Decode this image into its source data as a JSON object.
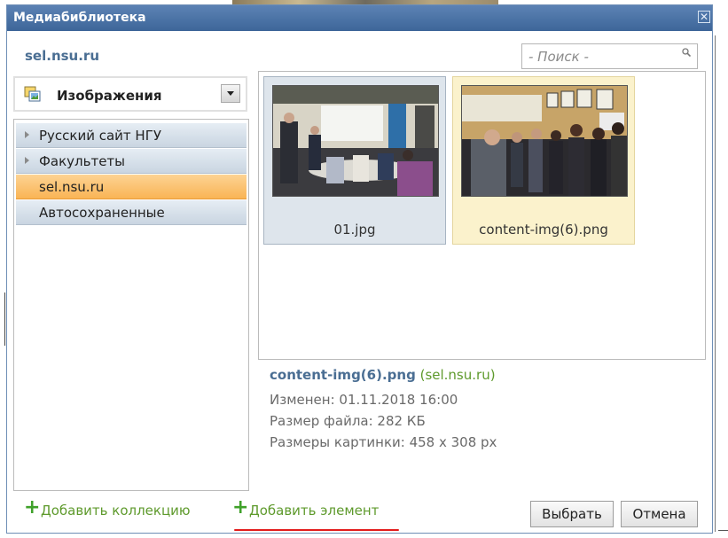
{
  "window": {
    "title": "Медиабиблиотека",
    "close_glyph": "✕"
  },
  "header": {
    "site_name": "sel.nsu.ru"
  },
  "search": {
    "placeholder": "- Поиск -",
    "icon": "search-icon"
  },
  "type_selector": {
    "selected": "Изображения",
    "icon": "images-icon"
  },
  "tree": {
    "items": [
      {
        "label": "Русский сайт НГУ",
        "expandable": true,
        "selected": false
      },
      {
        "label": "Факультеты",
        "expandable": true,
        "selected": false
      },
      {
        "label": "sel.nsu.ru",
        "expandable": false,
        "selected": true
      },
      {
        "label": "Автосохраненные",
        "expandable": false,
        "selected": false
      }
    ]
  },
  "gallery": {
    "items": [
      {
        "filename": "01.jpg",
        "selected": false
      },
      {
        "filename": "content-img(6).png",
        "selected": true
      }
    ]
  },
  "details": {
    "filename": "content-img(6).png",
    "collection": "(sel.nsu.ru)",
    "modified": "Изменен: 01.11.2018 16:00",
    "file_size": "Размер файла: 282 КБ",
    "dimensions": "Размеры картинки: 458 x 308 px"
  },
  "footer": {
    "add_collection": "Добавить коллекцию",
    "add_element": "Добавить элемент",
    "select_button": "Выбрать",
    "cancel_button": "Отмена"
  },
  "colors": {
    "title_bar": "#4a72a6",
    "accent_green": "#5e9a2c",
    "selected_tree_item": "#fbc06b",
    "selected_thumb_bg": "#fbf2cc",
    "underline_red": "#e21b1b"
  }
}
